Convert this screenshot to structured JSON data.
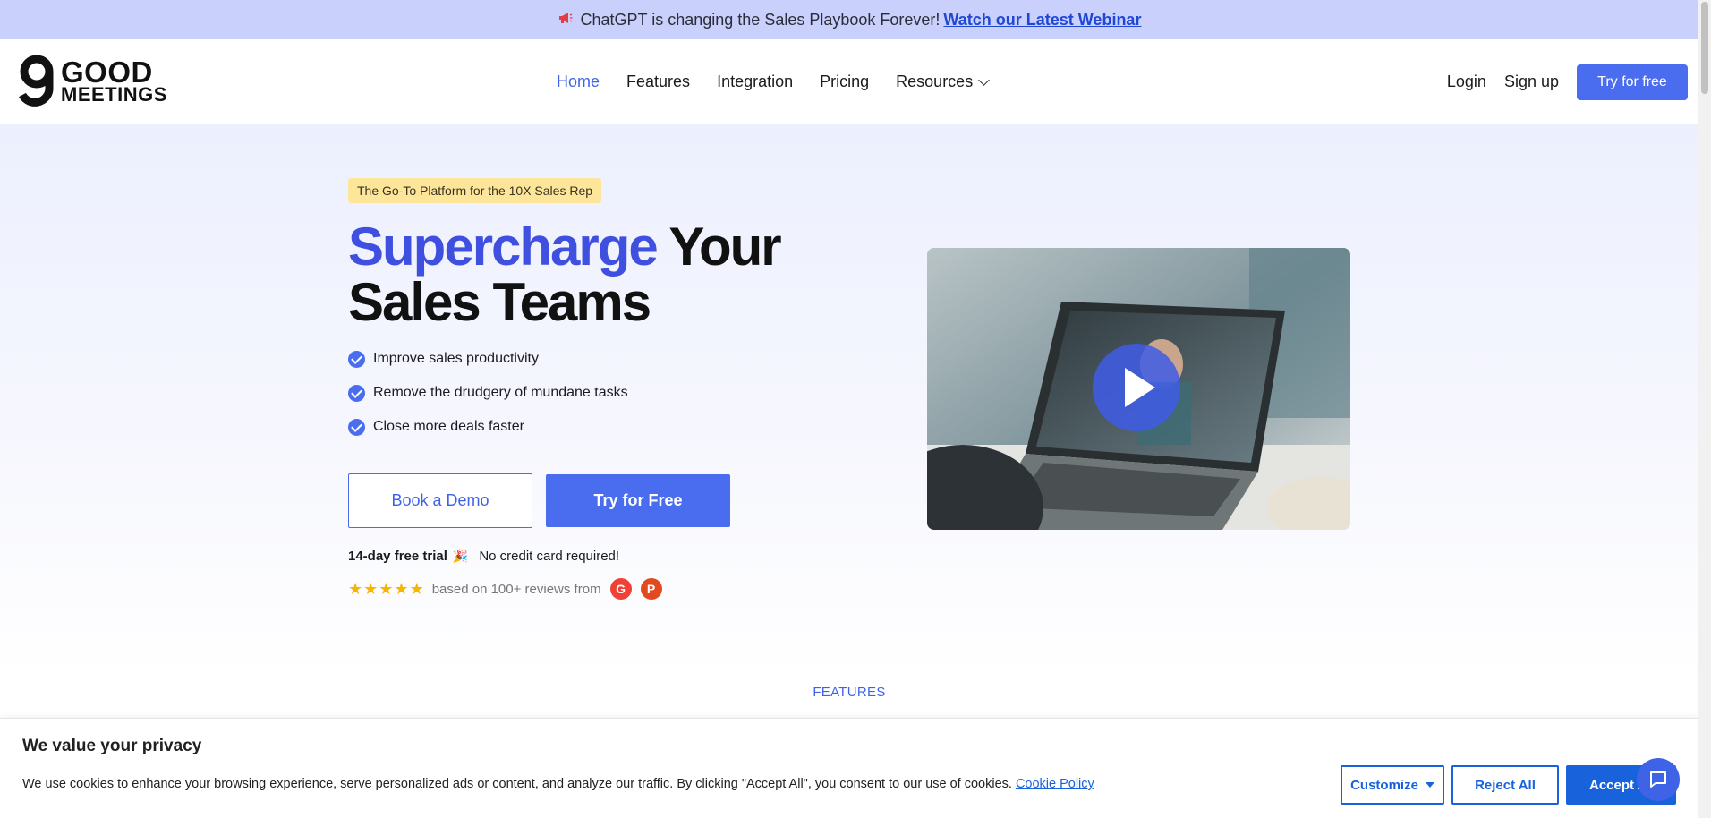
{
  "announcement": {
    "text": "ChatGPT is changing the Sales Playbook Forever!",
    "link": "Watch our Latest Webinar"
  },
  "brand": {
    "line1": "GOOD",
    "line2": "MEETINGS"
  },
  "nav": {
    "items": [
      {
        "label": "Home",
        "active": true
      },
      {
        "label": "Features"
      },
      {
        "label": "Integration"
      },
      {
        "label": "Pricing"
      },
      {
        "label": "Resources"
      }
    ],
    "login": "Login",
    "signup": "Sign up",
    "cta": "Try for free"
  },
  "hero": {
    "tagline": "The Go-To Platform for the 10X Sales Rep",
    "headline_accent": "Supercharge",
    "headline_rest1": "Your",
    "headline_rest2": "Sales Teams",
    "bullets": [
      "Improve sales productivity",
      "Remove the drudgery of mundane tasks",
      "Close more deals faster"
    ],
    "demo_button": "Book a Demo",
    "try_button": "Try for Free",
    "trial_bold": "14-day free trial",
    "trial_rest": "No credit card required!",
    "reviews_text": "based on 100+ reviews from",
    "rating": 5
  },
  "sections": {
    "features_label": "FEATURES"
  },
  "cookie": {
    "title": "We value your privacy",
    "body": "We use cookies to enhance your browsing experience, serve personalized ads or content, and analyze our traffic. By clicking \"Accept All\", you consent to our use of cookies.",
    "policy_link": "Cookie Policy",
    "customize": "Customize",
    "reject": "Reject All",
    "accept": "Accept All"
  },
  "colors": {
    "accent": "#4a6df0",
    "headline_accent": "#3f4fe0",
    "announce_bg": "#c9d0fb",
    "cookie_blue": "#1863dc"
  }
}
